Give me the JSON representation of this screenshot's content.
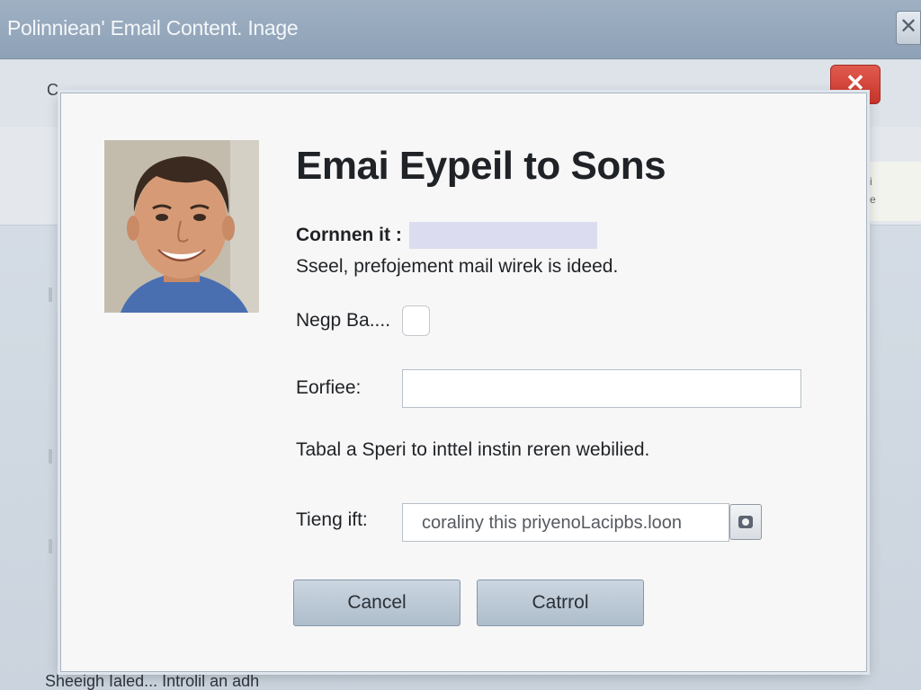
{
  "window": {
    "title": "Polinniean' Email Content. Inage",
    "close_glyph": "✕",
    "behind_text": "C",
    "behind_right_text": "i\ne",
    "behind_bottom_text": "Sheeigh Ialed... Introlil an adh"
  },
  "red_close": {
    "glyph": "✕"
  },
  "dialog": {
    "title": "Emai Eypeil to Sons",
    "comment_label": "Cornnen it :",
    "comment_desc": "Sseel, prefojement mail wirek is ideed.",
    "checkbox_label": "Negp Ba....",
    "field_label": "Eorfiee:",
    "field_value": "",
    "hint_text": "Tabal a Speri to inttel instin reren webilied.",
    "url_label": "Tieng ift:",
    "url_value": "coraliny this priyenoLacipbs.loon",
    "cancel_label": "Cancel",
    "confirm_label": "Catrrol"
  },
  "colors": {
    "title_bar": "#94a6ba",
    "button": "#bcc9d6",
    "close_red": "#d3463a",
    "highlight": "#dcdcf0"
  },
  "icons": {
    "window_close": "close-icon",
    "dialog_close": "close-icon",
    "url_action": "image-icon"
  }
}
